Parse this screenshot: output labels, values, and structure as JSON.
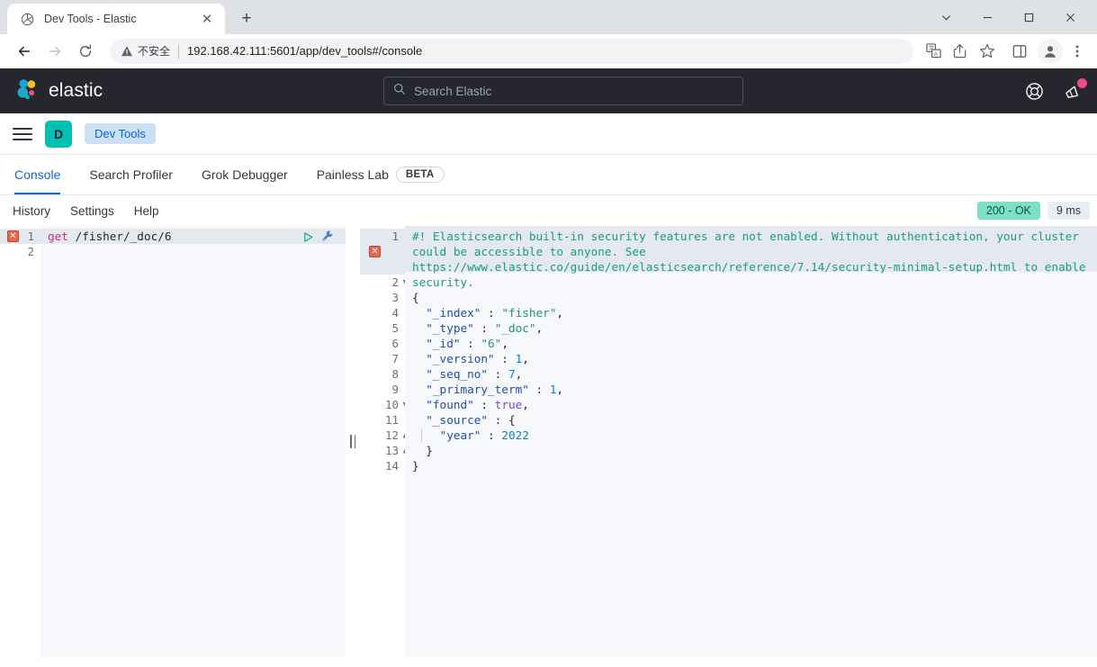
{
  "browser": {
    "tab": {
      "title": "Dev Tools - Elastic",
      "favicon_icon": "elastic-favicon",
      "close_icon": "close-icon"
    },
    "new_tab_icon": "plus-icon",
    "window_controls": {
      "minimize_dropdown_icon": "chevron-down-icon",
      "minimize_icon": "minimize-icon",
      "maximize_icon": "maximize-icon",
      "close_icon": "window-close-icon"
    },
    "nav": {
      "back_icon": "back-arrow-icon",
      "forward_icon": "forward-arrow-icon",
      "reload_icon": "reload-icon"
    },
    "omnibox": {
      "security_label": "不安全",
      "security_icon": "warning-triangle-icon",
      "url": "192.168.42.111:5601/app/dev_tools#/console"
    },
    "toolbar_icons": [
      "translate-icon",
      "share-icon",
      "bookmark-star-icon",
      "side-panel-icon",
      "profile-avatar-icon",
      "chrome-menu-icon"
    ]
  },
  "elastic_header": {
    "logo_icon": "elastic-logo-icon",
    "brand": "elastic",
    "search": {
      "placeholder": "Search Elastic",
      "icon": "search-icon"
    },
    "right_icons": [
      "help-lifebuoy-icon",
      "news-announcement-icon"
    ],
    "news_badge": true
  },
  "breadcrumb": {
    "menu_icon": "hamburger-menu-icon",
    "space_initial": "D",
    "current": "Dev Tools"
  },
  "app_tabs": [
    {
      "label": "Console",
      "active": true
    },
    {
      "label": "Search Profiler",
      "active": false
    },
    {
      "label": "Grok Debugger",
      "active": false
    },
    {
      "label": "Painless Lab",
      "active": false,
      "badge": "BETA"
    }
  ],
  "console_toolbar": {
    "items": [
      "History",
      "Settings",
      "Help"
    ],
    "status_code": "200 - OK",
    "elapsed": "9 ms"
  },
  "editor": {
    "error_marker": "✕",
    "run_icon": "play-triangle-icon",
    "wrench_icon": "wrench-icon",
    "lines": [
      {
        "n": "1",
        "method": "get",
        "path": " /fisher/_doc/6"
      },
      {
        "n": "2",
        "method": "",
        "path": ""
      }
    ]
  },
  "response": {
    "warning": "#! Elasticsearch built-in security features are not enabled. Without authentication, your cluster could be accessible to anyone. See https://www.elastic.co/guide/en/elasticsearch/reference/7.14/security-minimal-setup.html to enable security.",
    "error_marker": "✕",
    "line_numbers": [
      "1",
      "2",
      "3",
      "4",
      "5",
      "6",
      "7",
      "8",
      "9",
      "10",
      "11",
      "12",
      "13",
      "14"
    ],
    "body": {
      "open_brace": "{",
      "fields": [
        {
          "key": "\"_index\"",
          "sep": " : ",
          "value": "\"fisher\"",
          "type": "str",
          "comma": ","
        },
        {
          "key": "\"_type\"",
          "sep": " : ",
          "value": "\"_doc\"",
          "type": "str",
          "comma": ","
        },
        {
          "key": "\"_id\"",
          "sep": " : ",
          "value": "\"6\"",
          "type": "str",
          "comma": ","
        },
        {
          "key": "\"_version\"",
          "sep": " : ",
          "value": "1",
          "type": "num",
          "comma": ","
        },
        {
          "key": "\"_seq_no\"",
          "sep": " : ",
          "value": "7",
          "type": "num",
          "comma": ","
        },
        {
          "key": "\"_primary_term\"",
          "sep": " : ",
          "value": "1",
          "type": "num",
          "comma": ","
        },
        {
          "key": "\"found\"",
          "sep": " : ",
          "value": "true",
          "type": "bool",
          "comma": ","
        },
        {
          "key": "\"_source\"",
          "sep": " : ",
          "value": "{",
          "type": "punct",
          "comma": ""
        },
        {
          "key": "\"year\"",
          "sep": " : ",
          "value": "2022",
          "type": "num",
          "comma": "",
          "indent": 2
        }
      ],
      "close_inner": "}",
      "close_brace": "}"
    }
  }
}
